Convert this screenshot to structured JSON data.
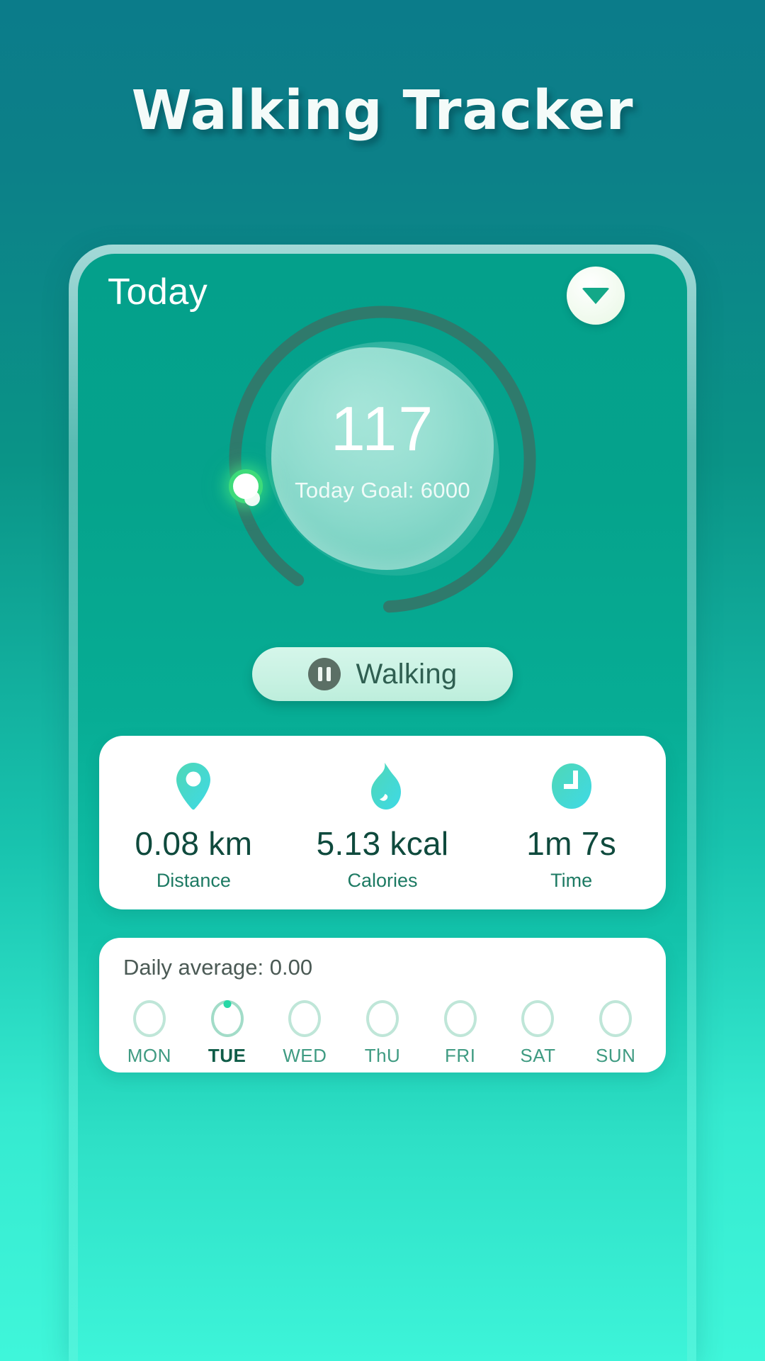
{
  "app": {
    "title": "Walking Tracker",
    "bg_top_color": "#0b7c8a",
    "bg_bottom_color": "#3ff6da"
  },
  "screen": {
    "header": {
      "title": "Today",
      "dropdown_icon": "chevron-down-icon"
    },
    "progress": {
      "steps": "117",
      "goal_text": "Today Goal: 6000",
      "goal_value": 6000,
      "percent": 1.95,
      "track_color": "#2f7a6c",
      "indicator_color": "#3ddb7a",
      "blob_color": "#8ddbcd"
    },
    "activity_button": {
      "label": "Walking",
      "icon": "pause-icon",
      "state": "running"
    },
    "stats": [
      {
        "icon": "location-pin-icon",
        "value": "0.08 km",
        "label": "Distance"
      },
      {
        "icon": "flame-icon",
        "value": "5.13 kcal",
        "label": "Calories"
      },
      {
        "icon": "clock-icon",
        "value": "1m 7s",
        "label": "Time"
      }
    ],
    "week": {
      "daily_average_label": "Daily average: 0.00",
      "days": [
        {
          "name": "MON",
          "active": false
        },
        {
          "name": "TUE",
          "active": true
        },
        {
          "name": "WED",
          "active": false
        },
        {
          "name": "ThU",
          "active": false
        },
        {
          "name": "FRI",
          "active": false
        },
        {
          "name": "SAT",
          "active": false
        },
        {
          "name": "SUN",
          "active": false
        }
      ]
    }
  }
}
